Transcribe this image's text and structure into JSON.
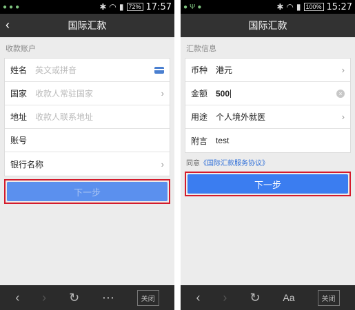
{
  "left": {
    "status": {
      "battery": "72%",
      "time": "17:57"
    },
    "title": "国际汇款",
    "section": "收款账户",
    "rows": [
      {
        "label": "姓名",
        "placeholder": "英文或拼音"
      },
      {
        "label": "国家",
        "placeholder": "收款人常驻国家"
      },
      {
        "label": "地址",
        "placeholder": "收款人联系地址"
      },
      {
        "label": "账号",
        "placeholder": ""
      },
      {
        "label": "银行名称",
        "placeholder": ""
      }
    ],
    "next_button": "下一步",
    "close_label": "关闭"
  },
  "right": {
    "status": {
      "battery": "100%",
      "time": "15:27"
    },
    "title": "国际汇款",
    "section": "汇款信息",
    "rows": [
      {
        "label": "币种",
        "value": "港元"
      },
      {
        "label": "金额",
        "value": "500"
      },
      {
        "label": "用途",
        "value": "个人境外就医"
      },
      {
        "label": "附言",
        "value": "test"
      }
    ],
    "agree_prefix": "同意",
    "agree_link": "《国际汇款服务协议》",
    "next_button": "下一步",
    "aa_label": "Aa",
    "close_label": "关闭"
  },
  "colors": {
    "accent": "#3b7df0",
    "highlight": "#d41b2c",
    "bar": "#323232"
  }
}
